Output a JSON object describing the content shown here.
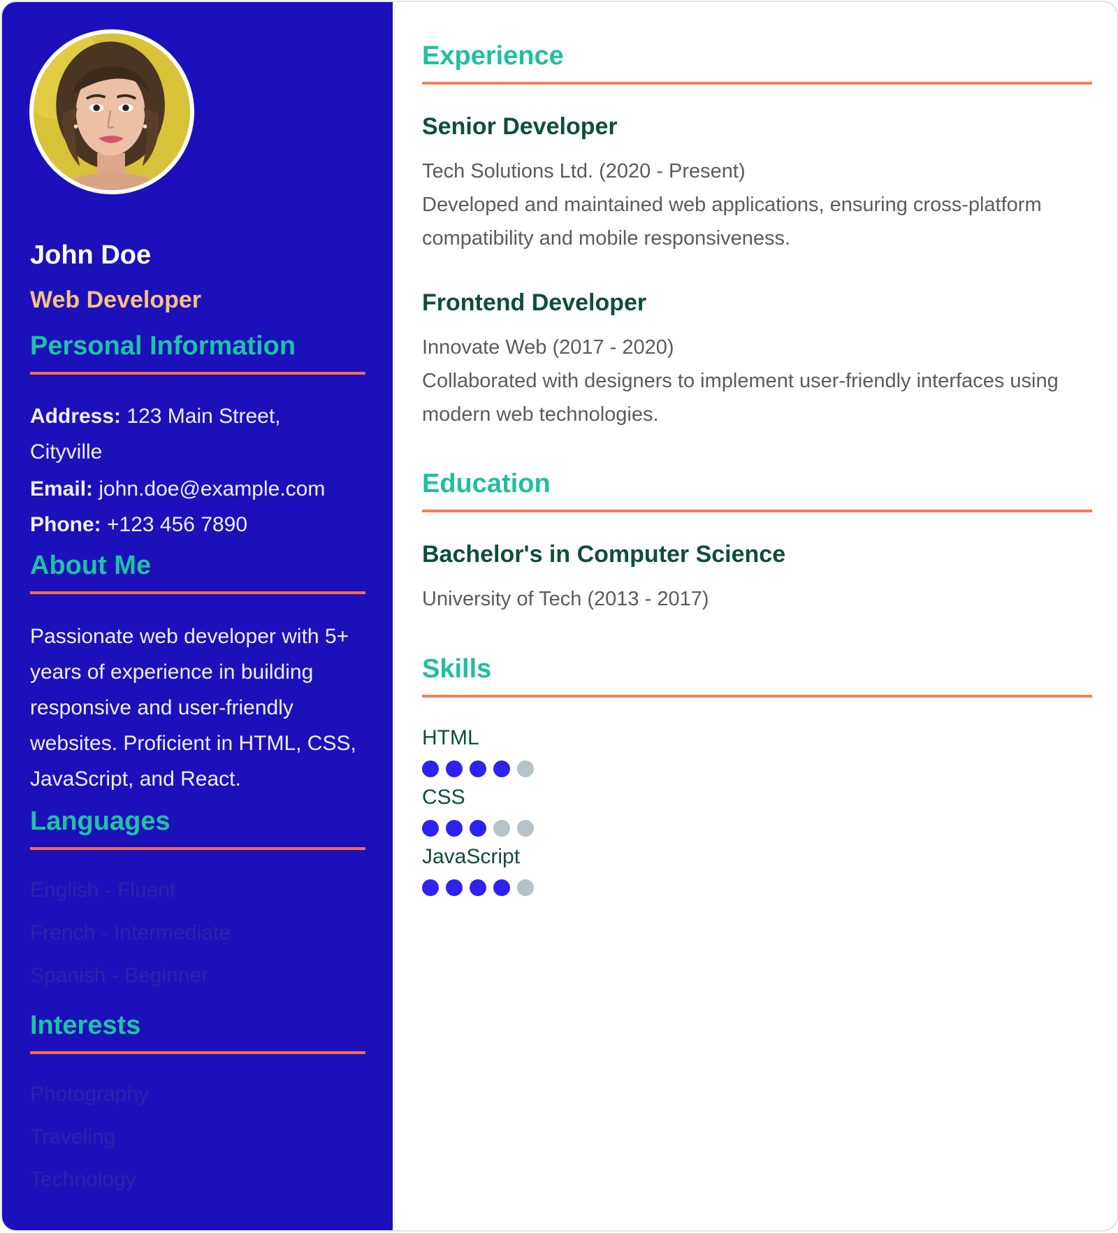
{
  "profile": {
    "name": "John Doe",
    "title": "Web Developer"
  },
  "personal": {
    "heading": "Personal Information",
    "address_label": "Address:",
    "address_line1": "123 Main Street,",
    "address_line2": "Cityville",
    "email_label": "Email:",
    "email": "john.doe@example.com",
    "phone_label": "Phone:",
    "phone": "+123 456 7890"
  },
  "about": {
    "heading": "About Me",
    "text": "Passionate web developer with 5+ years of experience in building responsive and user-friendly websites. Proficient in HTML, CSS, JavaScript, and React."
  },
  "languages": {
    "heading": "Languages",
    "items": [
      "English - Fluent",
      "French - Intermediate",
      "Spanish - Beginner"
    ]
  },
  "interests": {
    "heading": "Interests",
    "items": [
      "Photography",
      "Traveling",
      "Technology"
    ]
  },
  "experience": {
    "heading": "Experience",
    "jobs": [
      {
        "title": "Senior Developer",
        "company": "Tech Solutions Ltd. (2020 - Present)",
        "description": "Developed and maintained web applications, ensuring cross-platform compatibility and mobile responsiveness."
      },
      {
        "title": "Frontend Developer",
        "company": "Innovate Web (2017 - 2020)",
        "description": "Collaborated with designers to implement user-friendly interfaces using modern web technologies."
      }
    ]
  },
  "education": {
    "heading": "Education",
    "degree": "Bachelor's in Computer Science",
    "school": "University of Tech (2013 - 2017)"
  },
  "skills": {
    "heading": "Skills",
    "max_level": 5,
    "items": [
      {
        "name": "HTML",
        "level": 4
      },
      {
        "name": "CSS",
        "level": 3
      },
      {
        "name": "JavaScript",
        "level": 4
      }
    ]
  },
  "colors": {
    "sidebar_bg": "#1c10bb",
    "heading_accent": "#1fc3a2",
    "rule_accent": "#ff6d4d",
    "title_accent": "#f7c27e",
    "skill_dot_on": "#2d22f2",
    "skill_dot_off": "#b6c1c8"
  }
}
